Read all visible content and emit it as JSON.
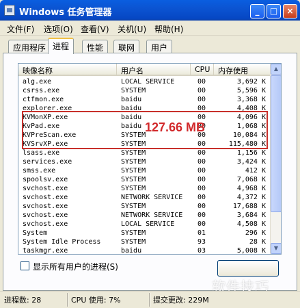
{
  "window": {
    "title": "Windows 任务管理器",
    "minimize": "_",
    "maximize": "□",
    "close": "×"
  },
  "menu": [
    "文件(F)",
    "选项(O)",
    "查看(V)",
    "关机(U)",
    "帮助(H)"
  ],
  "tabs": [
    "应用程序",
    "进程",
    "性能",
    "联网",
    "用户"
  ],
  "active_tab": "进程",
  "columns": [
    "映像名称",
    "用户名",
    "CPU",
    "内存使用"
  ],
  "rows": [
    {
      "name": "alg.exe",
      "user": "LOCAL SERVICE",
      "cpu": "00",
      "mem": "3,692 K"
    },
    {
      "name": "csrss.exe",
      "user": "SYSTEM",
      "cpu": "00",
      "mem": "5,596 K"
    },
    {
      "name": "ctfmon.exe",
      "user": "baidu",
      "cpu": "00",
      "mem": "3,368 K"
    },
    {
      "name": "explorer.exe",
      "user": "baidu",
      "cpu": "00",
      "mem": "4,408 K"
    },
    {
      "name": "KVMonXP.exe",
      "user": "baidu",
      "cpu": "00",
      "mem": "4,096 K"
    },
    {
      "name": "KvPad.exe",
      "user": "baidu",
      "cpu": "00",
      "mem": "1,068 K"
    },
    {
      "name": "KVPreScan.exe",
      "user": "SYSTEM",
      "cpu": "00",
      "mem": "10,084 K"
    },
    {
      "name": "KVSrvXP.exe",
      "user": "SYSTEM",
      "cpu": "00",
      "mem": "115,480 K"
    },
    {
      "name": "lsass.exe",
      "user": "SYSTEM",
      "cpu": "00",
      "mem": "1,156 K"
    },
    {
      "name": "services.exe",
      "user": "SYSTEM",
      "cpu": "00",
      "mem": "3,424 K"
    },
    {
      "name": "smss.exe",
      "user": "SYSTEM",
      "cpu": "00",
      "mem": "412 K"
    },
    {
      "name": "spoolsv.exe",
      "user": "SYSTEM",
      "cpu": "00",
      "mem": "7,068 K"
    },
    {
      "name": "svchost.exe",
      "user": "SYSTEM",
      "cpu": "00",
      "mem": "4,968 K"
    },
    {
      "name": "svchost.exe",
      "user": "NETWORK SERVICE",
      "cpu": "00",
      "mem": "4,372 K"
    },
    {
      "name": "svchost.exe",
      "user": "SYSTEM",
      "cpu": "00",
      "mem": "17,688 K"
    },
    {
      "name": "svchost.exe",
      "user": "NETWORK SERVICE",
      "cpu": "00",
      "mem": "3,684 K"
    },
    {
      "name": "svchost.exe",
      "user": "LOCAL SERVICE",
      "cpu": "00",
      "mem": "4,508 K"
    },
    {
      "name": "System",
      "user": "SYSTEM",
      "cpu": "01",
      "mem": "296 K"
    },
    {
      "name": "System Idle Process",
      "user": "SYSTEM",
      "cpu": "93",
      "mem": "28 K"
    },
    {
      "name": "taskmgr.exe",
      "user": "baidu",
      "cpu": "03",
      "mem": "5,008 K"
    }
  ],
  "annotation": "127.66 MB",
  "show_all_label": "显示所有用户的进程(S)",
  "status": {
    "processes": "进程数: 28",
    "cpu": "CPU 使用: 7%",
    "commit": "提交更改: 229M"
  },
  "watermark": "软件技巧",
  "colors": {
    "title_bar": "#0a5ee0",
    "highlight": "#c8302b"
  }
}
